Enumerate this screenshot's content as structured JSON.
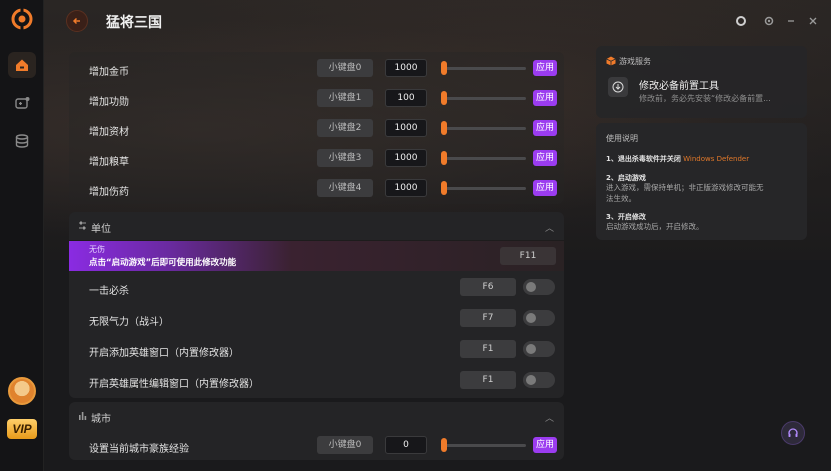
{
  "app": {
    "title": "猛将三国"
  },
  "sidebar": {
    "vip_label": "VIP"
  },
  "resources": [
    {
      "label": "增加金币",
      "key": "小键盘0",
      "value": "1000",
      "apply": "应用"
    },
    {
      "label": "增加功勋",
      "key": "小键盘1",
      "value": "100",
      "apply": "应用"
    },
    {
      "label": "增加资材",
      "key": "小键盘2",
      "value": "1000",
      "apply": "应用"
    },
    {
      "label": "增加粮草",
      "key": "小键盘3",
      "value": "1000",
      "apply": "应用"
    },
    {
      "label": "增加伤药",
      "key": "小键盘4",
      "value": "1000",
      "apply": "应用"
    }
  ],
  "unit_section": {
    "title": "单位",
    "banner": {
      "tag": "无伤",
      "notice": "点击“启动游戏”后即可使用此修改功能",
      "hotkey": "F11"
    },
    "rows": [
      {
        "label": "一击必杀",
        "hotkey": "F6"
      },
      {
        "label": "无限气力（战斗）",
        "hotkey": "F7"
      },
      {
        "label": "开启添加英雄窗口（内置修改器）",
        "hotkey": "F1"
      },
      {
        "label": "开启英雄属性编辑窗口（内置修改器）",
        "hotkey": "F1"
      }
    ]
  },
  "city_section": {
    "title": "城市",
    "rows": [
      {
        "label": "设置当前城市豪族经验",
        "key": "小键盘0",
        "value": "0",
        "apply": "应用"
      }
    ]
  },
  "game_service": {
    "header": "游戏服务",
    "tool_title": "修改必备前置工具",
    "tool_desc": "修改前，务必先安装“修改必备前置..."
  },
  "instructions": {
    "header": "使用说明",
    "step1_prefix": "1、退出杀毒软件并关闭",
    "step1_highlight": "Windows Defender",
    "step2_title": "2、启动游戏",
    "step2_text": "进入游戏，需保持单机；非正版游戏修改可能无法生效。",
    "step3_title": "3、开启修改",
    "step3_text": "启动游戏成功后，开启修改。"
  },
  "colors": {
    "accent": "#f07b2a",
    "purple": "#9b3cf0",
    "highlight": "#e0782a"
  }
}
